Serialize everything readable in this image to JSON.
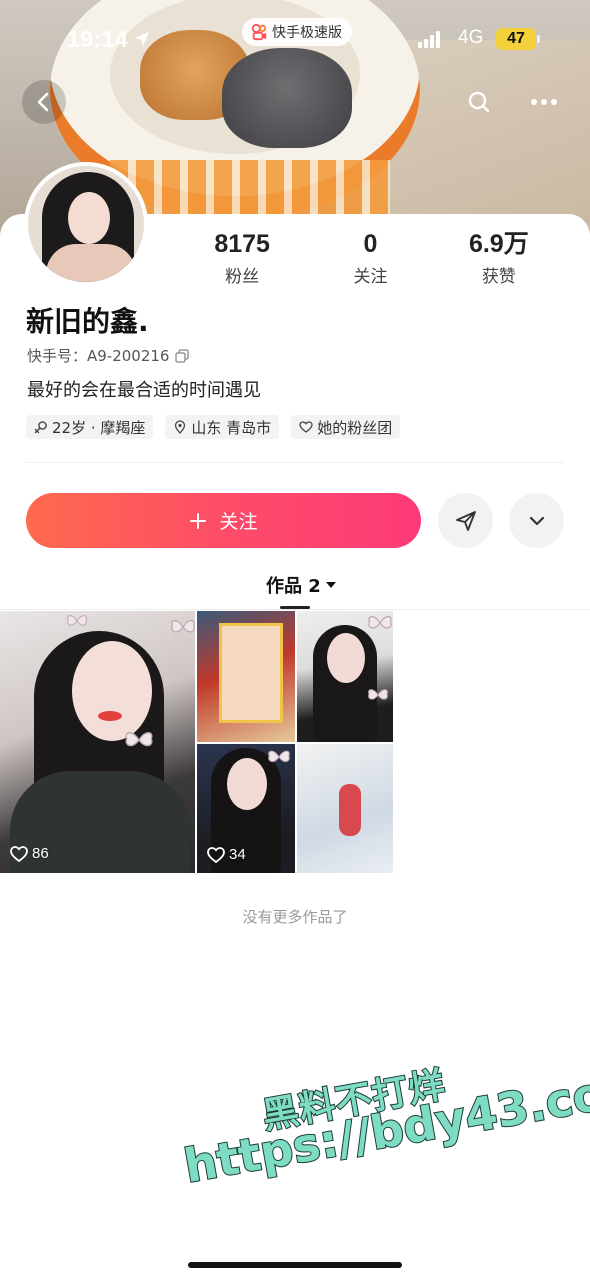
{
  "status_bar": {
    "time": "19:14",
    "app_pill": "快手极速版",
    "network": "4G",
    "battery": "47"
  },
  "profile": {
    "name": "新旧的鑫.",
    "kuaishou_id": "快手号：A9-200216",
    "bio": "最好的会在最合适的时间遇见",
    "tags": [
      {
        "icon": "gender-female-icon",
        "text": "22岁 · 摩羯座"
      },
      {
        "icon": "location-pin-icon",
        "text": "山东 青岛市"
      },
      {
        "icon": "fan-club-icon",
        "text": "她的粉丝团"
      }
    ]
  },
  "stats": [
    {
      "value": "8175",
      "label": "粉丝"
    },
    {
      "value": "0",
      "label": "关注"
    },
    {
      "value": "6.9万",
      "label": "获赞"
    }
  ],
  "actions": {
    "follow_label": "关注",
    "follow_icon": "plus-icon"
  },
  "tabs": {
    "works_label": "作品 2"
  },
  "works": [
    {
      "likes": "86"
    },
    {
      "likes": ""
    },
    {
      "likes": ""
    },
    {
      "likes": "34"
    },
    {
      "likes": ""
    }
  ],
  "footer": {
    "no_more": "没有更多作品了"
  },
  "watermark": {
    "line1": "黑料不打烊",
    "line2": "https://bdy43.co"
  },
  "colors": {
    "follow_gradient_start": "#ff6a4d",
    "follow_gradient_end": "#fd3a78",
    "battery": "#f2d13a",
    "watermark": "#7fdcc4"
  }
}
